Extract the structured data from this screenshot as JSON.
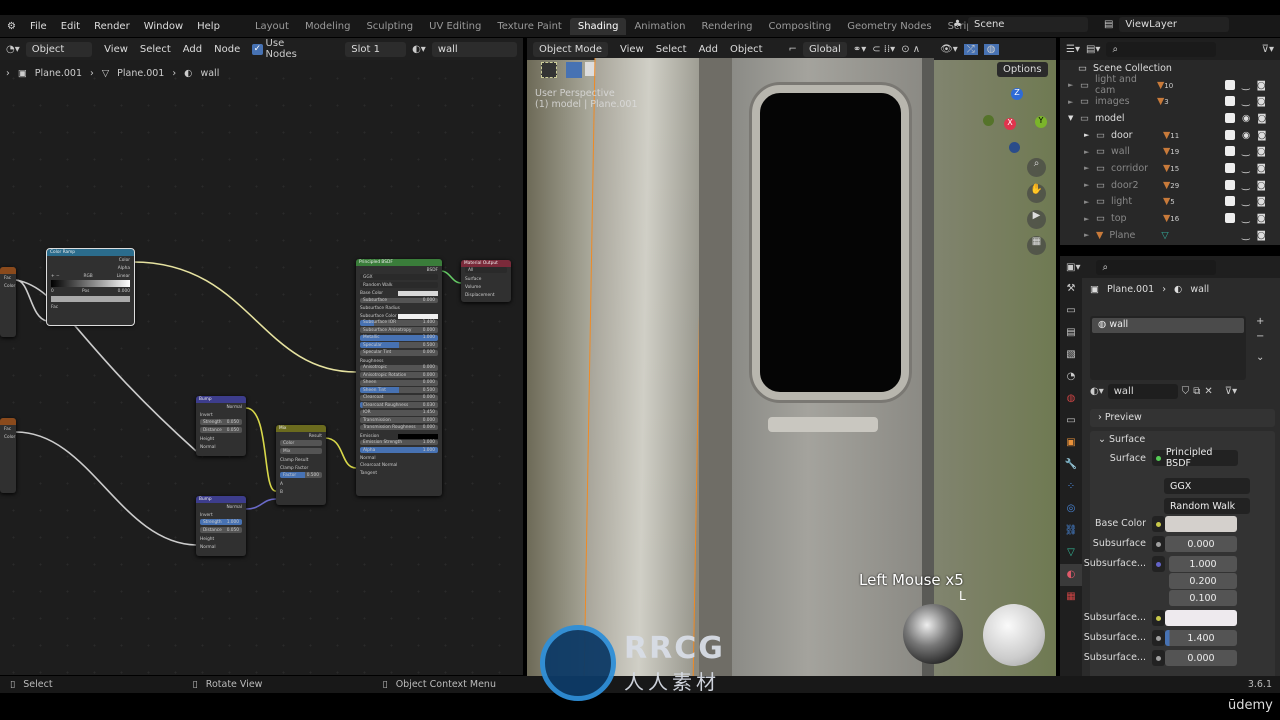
{
  "topbar": {
    "menus": [
      "File",
      "Edit",
      "Render",
      "Window",
      "Help"
    ],
    "workspaces": [
      "Layout",
      "Modeling",
      "Sculpting",
      "UV Editing",
      "Texture Paint",
      "Shading",
      "Animation",
      "Rendering",
      "Compositing",
      "Geometry Nodes",
      "Scripting"
    ],
    "active_workspace": "Shading",
    "add_tab": "+",
    "scene": "Scene",
    "view_layer": "ViewLayer"
  },
  "node_editor": {
    "editor_type": "Object",
    "menus": [
      "View",
      "Select",
      "Add",
      "Node"
    ],
    "use_nodes_label": "Use Nodes",
    "use_nodes": true,
    "slot": "Slot 1",
    "material": "wall",
    "breadcrumb": [
      "Plane.001",
      "Plane.001",
      "wall"
    ],
    "color_ramp": {
      "title": "Color Ramp",
      "outputs": [
        "Color",
        "Alpha"
      ],
      "mode": "RGB",
      "interp": "Linear",
      "index": "0",
      "pos_label": "Pos",
      "pos": "0.000",
      "input": "Fac"
    },
    "bump1": {
      "title": "Bump",
      "output": "Normal",
      "invert": "Invert",
      "strength_label": "Strength",
      "strength": "0.050",
      "distance_label": "Distance",
      "distance": "0.050",
      "inputs": [
        "Height",
        "Normal"
      ]
    },
    "bump2": {
      "title": "Bump",
      "output": "Normal",
      "invert": "Invert",
      "strength_label": "Strength",
      "strength": "1.000",
      "distance_label": "Distance",
      "distance": "0.050",
      "inputs": [
        "Height",
        "Normal"
      ]
    },
    "mix": {
      "title": "Mix",
      "output": "Result",
      "type": "Color",
      "blend": "Mix",
      "clamp_result": "Clamp Result",
      "clamp_factor": "Clamp Factor",
      "factor_label": "Factor",
      "factor": "0.500",
      "inputs": [
        "A",
        "B"
      ]
    },
    "tex_outputs": [
      "Fac",
      "Color"
    ],
    "principled": {
      "title": "Principled BSDF",
      "output": "BSDF",
      "distribution": "GGX",
      "subsurface_method": "Random Walk",
      "rows": [
        {
          "l": "Base Color",
          "t": "color",
          "c": "#d8d8d8"
        },
        {
          "l": "Subsurface",
          "v": "0.000"
        },
        {
          "l": "Subsurface Radius",
          "t": "menu"
        },
        {
          "l": "Subsurface Color",
          "t": "color",
          "c": "#f0f0f0"
        },
        {
          "l": "Subsurface IOR",
          "v": "1.400",
          "p": "18%"
        },
        {
          "l": "Subsurface Anisotropy",
          "v": "0.000"
        },
        {
          "l": "Metallic",
          "v": "1.000",
          "p": "100%"
        },
        {
          "l": "Specular",
          "v": "0.500",
          "p": "50%"
        },
        {
          "l": "Specular Tint",
          "v": "0.000"
        },
        {
          "l": "Roughness",
          "t": "socket"
        },
        {
          "l": "Anisotropic",
          "v": "0.000"
        },
        {
          "l": "Anisotropic Rotation",
          "v": "0.000"
        },
        {
          "l": "Sheen",
          "v": "0.000"
        },
        {
          "l": "Sheen Tint",
          "v": "0.500",
          "p": "50%"
        },
        {
          "l": "Clearcoat",
          "v": "0.000"
        },
        {
          "l": "Clearcoat Roughness",
          "v": "0.030",
          "p": "3%"
        },
        {
          "l": "IOR",
          "v": "1.450"
        },
        {
          "l": "Transmission",
          "v": "0.000"
        },
        {
          "l": "Transmission Roughness",
          "v": "0.000"
        },
        {
          "l": "Emission",
          "t": "color",
          "c": "#000000"
        },
        {
          "l": "Emission Strength",
          "v": "1.000"
        },
        {
          "l": "Alpha",
          "v": "1.000",
          "p": "100%"
        },
        {
          "l": "Normal",
          "t": "socket"
        },
        {
          "l": "Clearcoat Normal",
          "t": "socket"
        },
        {
          "l": "Tangent",
          "t": "socket"
        }
      ]
    },
    "material_output": {
      "title": "Material Output",
      "target": "All",
      "inputs": [
        "Surface",
        "Volume",
        "Displacement"
      ]
    }
  },
  "viewport": {
    "mode": "Object Mode",
    "menus": [
      "View",
      "Select",
      "Add",
      "Object"
    ],
    "orientation": "Global",
    "options": "Options",
    "overlay_title": "User Perspective",
    "overlay_sub": "(1) model | Plane.001",
    "gizmo": {
      "x": "X",
      "y": "Y",
      "z": "Z"
    },
    "key_hint": "Left Mouse x5",
    "key_hint_sub": "L"
  },
  "outliner": {
    "root": "Scene Collection",
    "items": [
      {
        "name": "light and cam",
        "count": "10",
        "depth": 0,
        "dim": true,
        "eye": false,
        "expanded": false
      },
      {
        "name": "images",
        "count": "3",
        "depth": 0,
        "dim": true,
        "eye": false,
        "expanded": false
      },
      {
        "name": "model",
        "count": "",
        "depth": 0,
        "dim": false,
        "eye": true,
        "expanded": true
      },
      {
        "name": "door",
        "count": "11",
        "depth": 1,
        "dim": false,
        "eye": true,
        "expanded": false
      },
      {
        "name": "wall",
        "count": "19",
        "depth": 1,
        "dim": true,
        "eye": false,
        "expanded": false
      },
      {
        "name": "corridor",
        "count": "15",
        "depth": 1,
        "dim": true,
        "eye": false,
        "expanded": false
      },
      {
        "name": "door2",
        "count": "29",
        "depth": 1,
        "dim": true,
        "eye": false,
        "expanded": false
      },
      {
        "name": "light",
        "count": "5",
        "depth": 1,
        "dim": true,
        "eye": false,
        "expanded": false
      },
      {
        "name": "top",
        "count": "16",
        "depth": 1,
        "dim": true,
        "eye": false,
        "expanded": false
      },
      {
        "name": "Plane",
        "count": "",
        "depth": 1,
        "dim": true,
        "eye": false,
        "expanded": false,
        "object": true
      }
    ]
  },
  "properties": {
    "breadcrumb": [
      "Plane.001",
      "wall"
    ],
    "slot": "wall",
    "material": "wall",
    "preview": "Preview",
    "surface_panel": "Surface",
    "surface_label": "Surface",
    "surface_shader": "Principled BSDF",
    "distribution": "GGX",
    "subsurface_method": "Random Walk",
    "fields": [
      {
        "l": "Base Color",
        "t": "color",
        "c": "#d4d0cc",
        "s": "#c8c84a"
      },
      {
        "l": "Subsurface",
        "v": "0.000",
        "s": "#a0a0a0"
      },
      {
        "l": "Subsurface...",
        "vec": [
          "1.000",
          "0.200",
          "0.100"
        ],
        "s": "#6363c7"
      },
      {
        "l": "Subsurface...",
        "t": "color",
        "c": "#eeeaee",
        "s": "#c8c84a"
      },
      {
        "l": "Subsurface...",
        "v": "1.400",
        "s": "#a0a0a0",
        "p": "6%"
      },
      {
        "l": "Subsurface...",
        "v": "0.000",
        "s": "#a0a0a0"
      }
    ]
  },
  "status": {
    "select": "Select",
    "rotate": "Rotate View",
    "context": "Object Context Menu",
    "version": "3.6.1"
  },
  "watermark": {
    "logo": "RRCG",
    "sub": "人人素材",
    "udemy": "ūdemy"
  },
  "colors": {
    "accent": "#4772b3",
    "selection": "#f08a24"
  }
}
